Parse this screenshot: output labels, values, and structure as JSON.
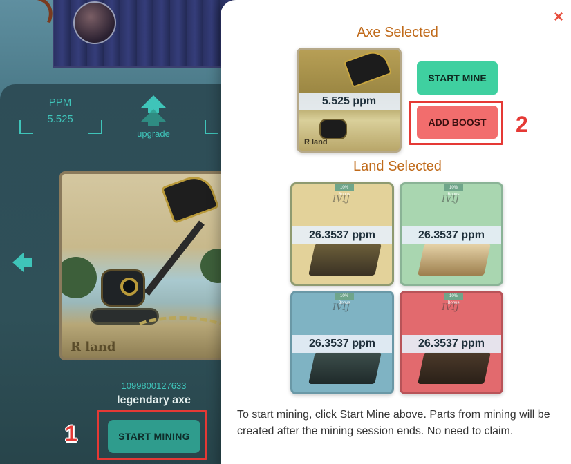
{
  "background": {
    "stats": {
      "ppm_label": "PPM",
      "ppm_value": "5.525",
      "upgrade_label": "upgrade"
    },
    "nft": {
      "id": "1099800127633",
      "name": "legendary axe",
      "logo_text": "R land"
    },
    "start_mining_label": "START MINING",
    "annotation_1": "1"
  },
  "modal": {
    "close_icon": "×",
    "axe_section": {
      "title": "Axe Selected",
      "ppm": "5.525 ppm",
      "logo_text": "R land"
    },
    "start_mine_label": "START MINE",
    "add_boost_label": "ADD BOOST",
    "annotation_2": "2",
    "land_section": {
      "title": "Land Selected",
      "lands": [
        {
          "ppm": "26.3537 ppm",
          "bonus": "10% Bonus",
          "watermark": "IVIJ"
        },
        {
          "ppm": "26.3537 ppm",
          "bonus": "10% Bonus",
          "watermark": "IVIJ"
        },
        {
          "ppm": "26.3537 ppm",
          "bonus": "10% Bonus",
          "watermark": "IVIJ"
        },
        {
          "ppm": "26.3537 ppm",
          "bonus": "10% Bonus",
          "watermark": "IVIJ"
        }
      ]
    },
    "help_text": "To start mining, click Start Mine above. Parts from mining will be created after the mining session ends. No need to claim."
  },
  "colors": {
    "accent_teal": "#3fc4b9",
    "start_mine_green": "#3fd0a0",
    "add_boost_red": "#f26d6d",
    "title_orange": "#c06a1a",
    "annotation_red": "#e53935"
  }
}
